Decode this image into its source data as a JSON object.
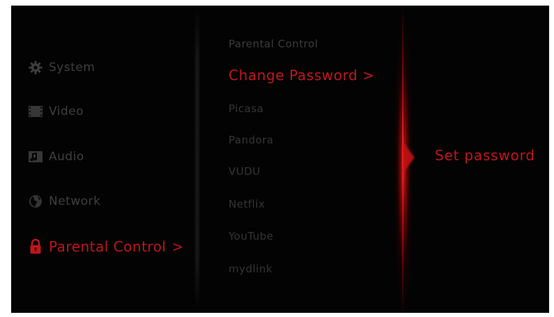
{
  "colors": {
    "background": "#030303",
    "accent": "#c0151b",
    "inactive_text": "#3f3f3f"
  },
  "menu": {
    "items": [
      {
        "label": "System",
        "icon": "gear-icon",
        "active": false
      },
      {
        "label": "Video",
        "icon": "film-icon",
        "active": false
      },
      {
        "label": "Audio",
        "icon": "music-note-icon",
        "active": false
      },
      {
        "label": "Network",
        "icon": "globe-icon",
        "active": false
      },
      {
        "label": "Parental Control",
        "icon": "lock-icon",
        "active": true,
        "suffix": ">"
      }
    ]
  },
  "submenu": {
    "header": "Parental Control",
    "items": [
      {
        "label": "Change Password >",
        "active": true
      },
      {
        "label": "Picasa",
        "active": false
      },
      {
        "label": "Pandora",
        "active": false
      },
      {
        "label": "VUDU",
        "active": false
      },
      {
        "label": "Netflix",
        "active": false
      },
      {
        "label": "YouTube",
        "active": false
      },
      {
        "label": "mydlink",
        "active": false
      }
    ]
  },
  "detail": {
    "label": "Set password"
  }
}
